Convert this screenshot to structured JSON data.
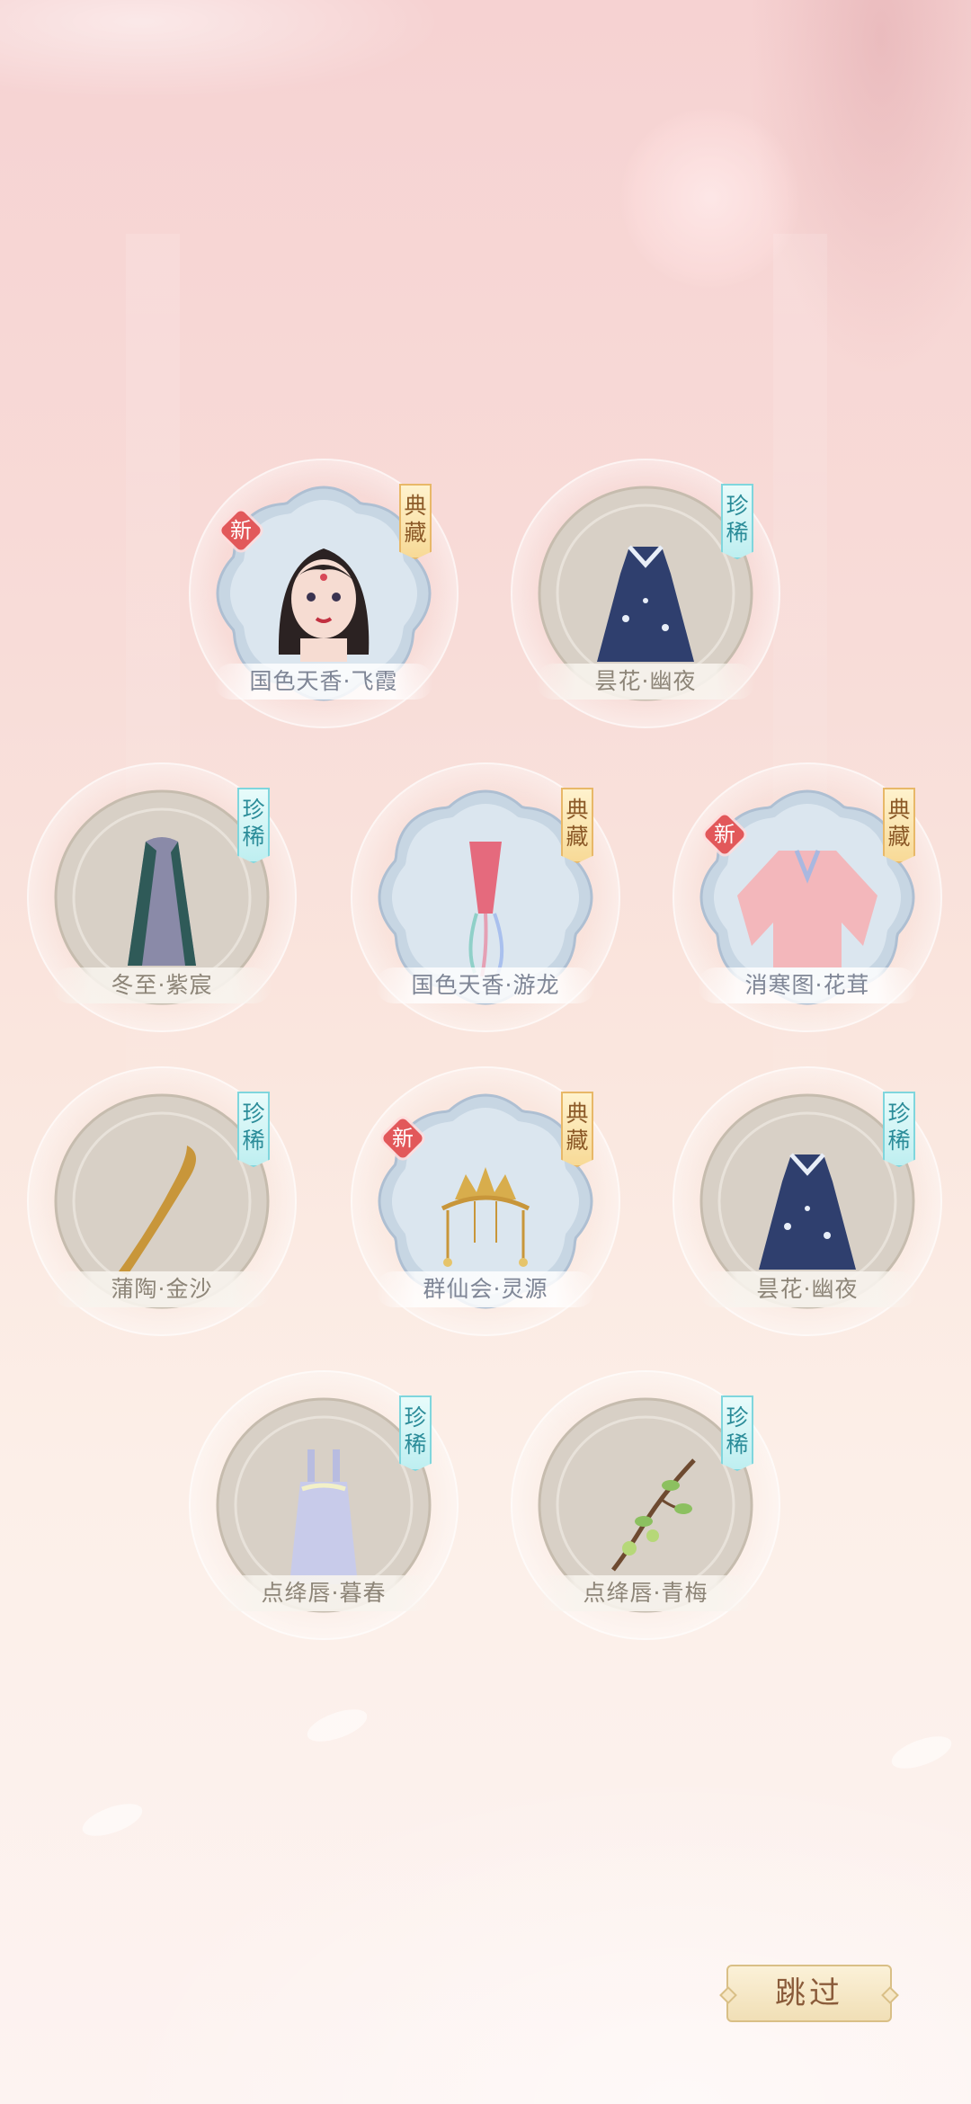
{
  "items": [
    {
      "name": "国色天香·飞霞",
      "tag": "典藏",
      "tag_type": "gold",
      "is_new": true,
      "frame": "cloud",
      "icon": "portrait-face-icon"
    },
    {
      "name": "昙花·幽夜",
      "tag": "珍稀",
      "tag_type": "teal",
      "is_new": false,
      "frame": "circle",
      "icon": "dress-icon"
    },
    {
      "name": "冬至·紫宸",
      "tag": "珍稀",
      "tag_type": "teal",
      "is_new": false,
      "frame": "circle",
      "icon": "cloak-icon"
    },
    {
      "name": "国色天香·游龙",
      "tag": "典藏",
      "tag_type": "gold",
      "is_new": false,
      "frame": "cloud",
      "icon": "ribbon-accessory-icon"
    },
    {
      "name": "消寒图·花茸",
      "tag": "典藏",
      "tag_type": "gold",
      "is_new": true,
      "frame": "cloud",
      "icon": "jacket-icon"
    },
    {
      "name": "蒲陶·金沙",
      "tag": "珍稀",
      "tag_type": "teal",
      "is_new": false,
      "frame": "circle",
      "icon": "golden-hairpiece-icon"
    },
    {
      "name": "群仙会·灵源",
      "tag": "典藏",
      "tag_type": "gold",
      "is_new": true,
      "frame": "cloud",
      "icon": "crown-headdress-icon"
    },
    {
      "name": "昙花·幽夜",
      "tag": "珍稀",
      "tag_type": "teal",
      "is_new": false,
      "frame": "circle",
      "icon": "dress-icon"
    },
    {
      "name": "点绛唇·暮春",
      "tag": "珍稀",
      "tag_type": "teal",
      "is_new": false,
      "frame": "circle",
      "icon": "lavender-dress-icon"
    },
    {
      "name": "点绛唇·青梅",
      "tag": "珍稀",
      "tag_type": "teal",
      "is_new": false,
      "frame": "circle",
      "icon": "plum-branch-icon"
    }
  ],
  "new_label": "新",
  "skip_label": "跳过",
  "colors": {
    "background_top": "#f6d2d2",
    "background_bottom": "#fdf3f1",
    "tag_gold": "#f7d995",
    "tag_teal": "#bdeef0",
    "new_badge": "#e2585a",
    "skip_button": "#f1dfb6"
  }
}
